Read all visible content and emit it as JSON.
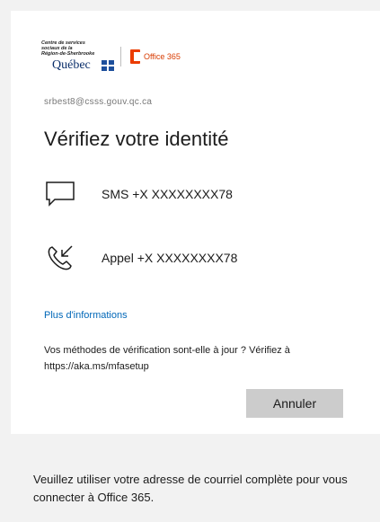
{
  "header": {
    "org_small_text": "Centre de services\nsociaux de la\nRégion-de-Sherbrooke",
    "org_wordmark": "Québec",
    "product_name": "Office 365"
  },
  "account": {
    "email": "srbest8@csss.gouv.qc.ca"
  },
  "page": {
    "title": "Vérifiez votre identité"
  },
  "methods": [
    {
      "icon": "sms-chat-icon",
      "label": "SMS +X XXXXXXXX78"
    },
    {
      "icon": "phone-call-icon",
      "label": "Appel +X XXXXXXXX78"
    }
  ],
  "more_info_link": "Plus d'informations",
  "verify_notice": "Vos méthodes de vérification sont-elle à jour ? Vérifiez à https://aka.ms/mfasetup",
  "buttons": {
    "cancel": "Annuler"
  },
  "footer_text": "Veuillez utiliser votre adresse de courriel complète pour vous connecter à Office 365.",
  "colors": {
    "link": "#0067b8",
    "office_orange": "#eb3c00",
    "button_bg": "#cccccc",
    "page_bg": "#f2f2f2"
  }
}
